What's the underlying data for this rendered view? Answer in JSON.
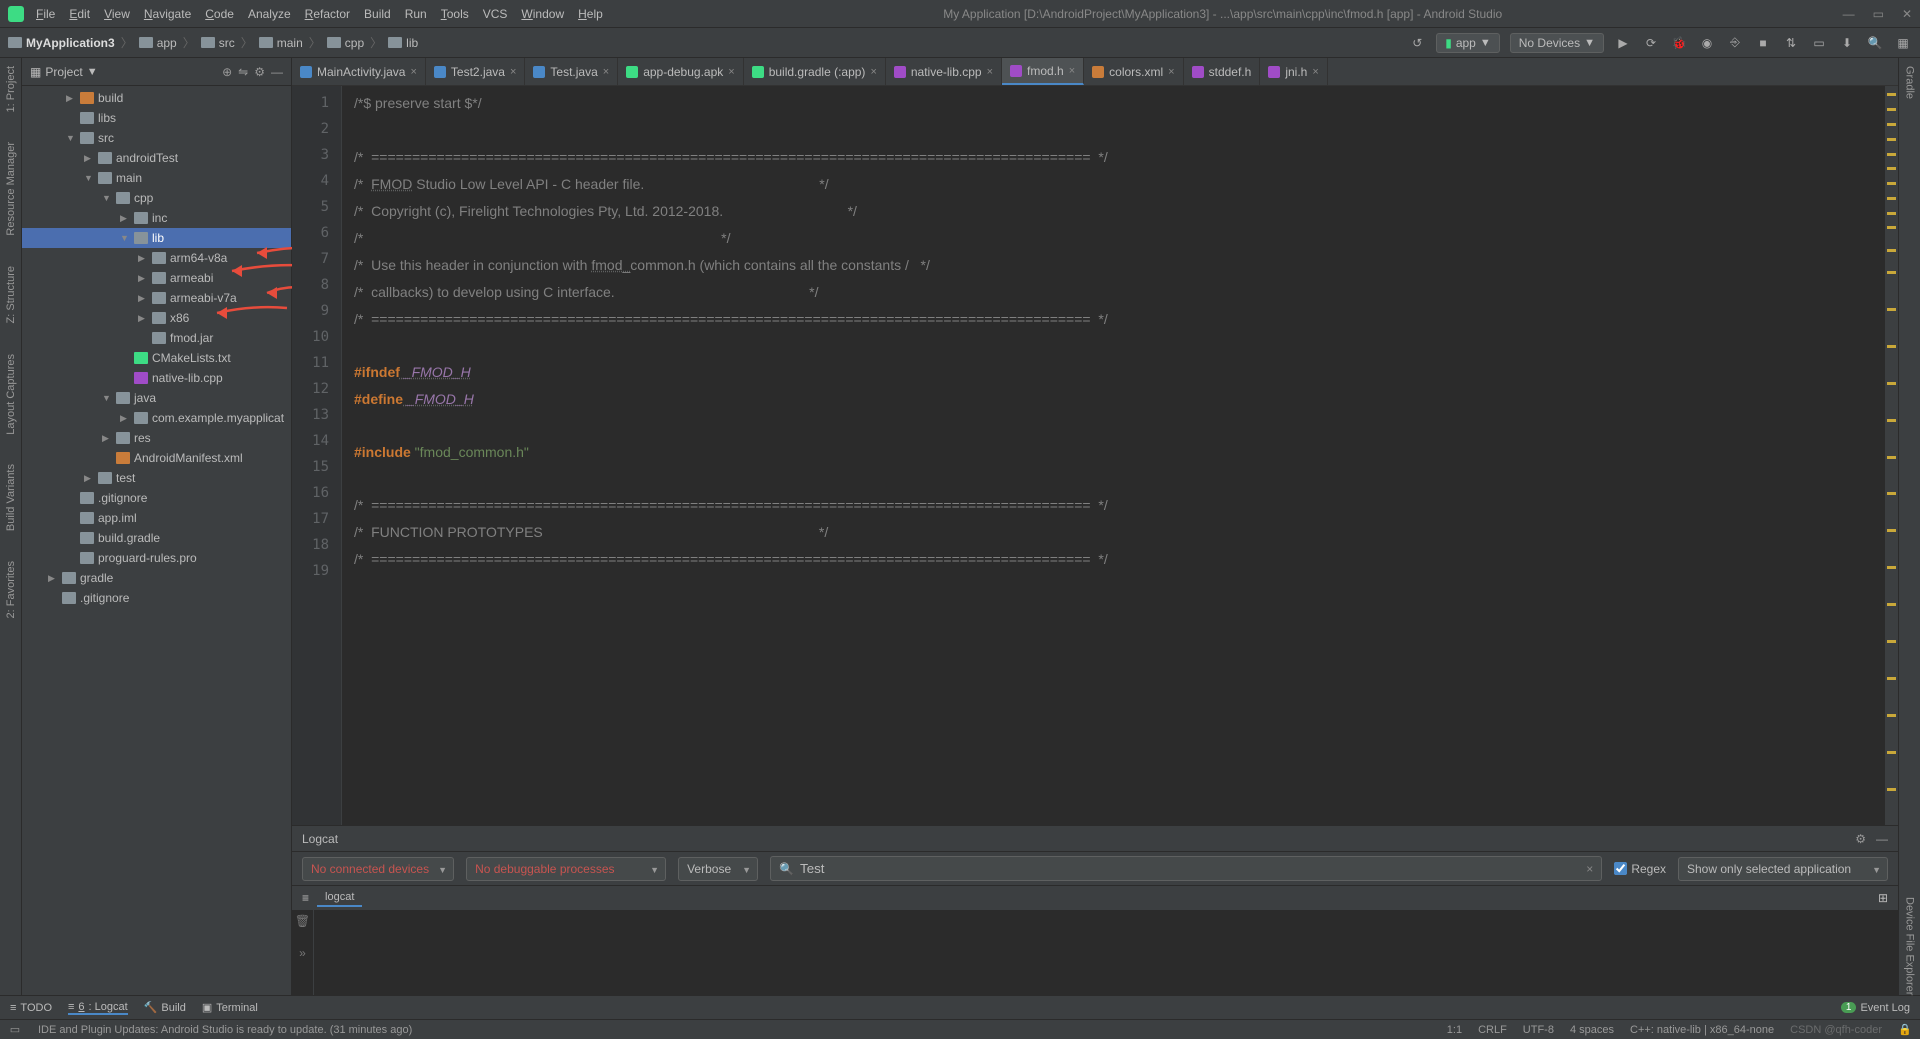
{
  "menu": {
    "file": "File",
    "edit": "Edit",
    "view": "View",
    "navigate": "Navigate",
    "code": "Code",
    "analyze": "Analyze",
    "refactor": "Refactor",
    "build": "Build",
    "run": "Run",
    "tools": "Tools",
    "vcs": "VCS",
    "window": "Window",
    "help": "Help"
  },
  "window_title": "My Application [D:\\AndroidProject\\MyApplication3] - ...\\app\\src\\main\\cpp\\inc\\fmod.h [app] - Android Studio",
  "breadcrumb": {
    "c0": "MyApplication3",
    "c1": "app",
    "c2": "src",
    "c3": "main",
    "c4": "cpp",
    "c5": "lib"
  },
  "toolbar": {
    "run_config": "app",
    "devices": "No Devices"
  },
  "left_strip": {
    "project": "1: Project",
    "resmgr": "Resource Manager",
    "structure": "Z: Structure",
    "captures": "Layout Captures",
    "variants": "Build Variants",
    "favorites": "2: Favorites"
  },
  "right_strip": {
    "gradle": "Gradle",
    "explorer": "Device File Explorer"
  },
  "project_panel": {
    "title": "Project",
    "tree": {
      "build": "build",
      "libs": "libs",
      "src": "src",
      "androidTest": "androidTest",
      "main": "main",
      "cpp": "cpp",
      "inc": "inc",
      "lib": "lib",
      "arm64v8a": "arm64-v8a",
      "armeabi": "armeabi",
      "armeabiv7a": "armeabi-v7a",
      "x86": "x86",
      "fmodjar": "fmod.jar",
      "cmakelists": "CMakeLists.txt",
      "nativelib": "native-lib.cpp",
      "java": "java",
      "pkg": "com.example.myapplicat",
      "res": "res",
      "manifest": "AndroidManifest.xml",
      "test": "test",
      "gitignore": ".gitignore",
      "appiml": "app.iml",
      "buildgradle": "build.gradle",
      "proguard": "proguard-rules.pro",
      "gradle": "gradle",
      "gitignore2": ".gitignore"
    }
  },
  "tabs": {
    "t0": "MainActivity.java",
    "t1": "Test2.java",
    "t2": "Test.java",
    "t3": "app-debug.apk",
    "t4": "build.gradle (:app)",
    "t5": "native-lib.cpp",
    "t6": "fmod.h",
    "t7": "colors.xml",
    "t8": "stddef.h",
    "t9": "jni.h"
  },
  "code": {
    "l1": "/*$ preserve start $*/",
    "l2": "",
    "l3": "/*  ========================================================================================  */",
    "l4a": "/*  ",
    "l4b": "FMOD",
    "l4c": " Studio Low Level API - C header file.                                             */",
    "l5": "/*  Copyright (c), Firelight Technologies Pty, Ltd. 2012-2018.                                */",
    "l6": "/*                                                                                            */",
    "l7a": "/*  Use this header in conjunction with ",
    "l7b": "fmod_",
    "l7c": "common.h (which contains all the constants /   */",
    "l8": "/*  callbacks) to develop using C interface.                                                  */",
    "l9": "/*  ========================================================================================  */",
    "l11a": "#ifndef",
    "l11b": " _FMOD_H",
    "l12a": "#define",
    "l12b": " _FMOD_H",
    "l14a": "#include",
    "l14b": " \"fmod_common.h\"",
    "l16": "/*  ========================================================================================  */",
    "l17": "/*  FUNCTION PROTOTYPES                                                                       */",
    "l18": "/*  ========================================================================================  */"
  },
  "logcat": {
    "title": "Logcat",
    "no_devices": "No connected devices",
    "no_process": "No debuggable processes",
    "level": "Verbose",
    "search_value": "Test",
    "search_placeholder": "",
    "regex": "Regex",
    "filter": "Show only selected application",
    "tab": "logcat"
  },
  "bottom": {
    "todo": "TODO",
    "logcat": "6: Logcat",
    "build": "Build",
    "terminal": "Terminal",
    "eventlog": "Event Log",
    "badge": "1"
  },
  "status": {
    "msg": "IDE and Plugin Updates: Android Studio is ready to update. (31 minutes ago)",
    "pos": "1:1",
    "eol": "CRLF",
    "enc": "UTF-8",
    "indent": "4 spaces",
    "context": "C++: native-lib | x86_64-none",
    "watermark": "CSDN @qfh-coder"
  }
}
